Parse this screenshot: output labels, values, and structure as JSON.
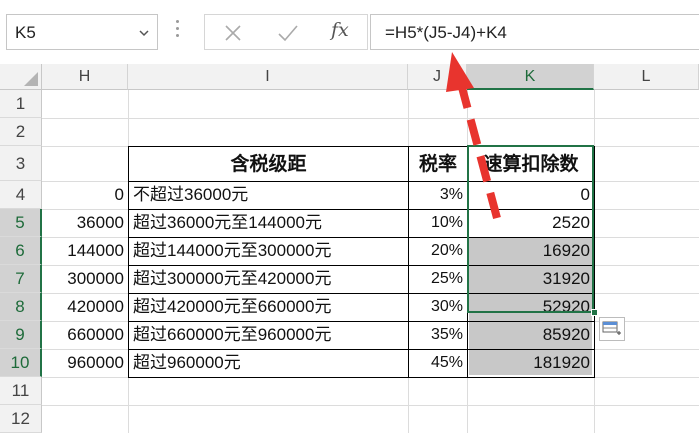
{
  "formula_bar": {
    "name_box": "K5",
    "fx_label": "fx",
    "formula": "=H5*(J5-J4)+K4"
  },
  "columns": [
    "H",
    "I",
    "J",
    "K",
    "L"
  ],
  "rows": [
    "1",
    "2",
    "3",
    "4",
    "5",
    "6",
    "7",
    "8",
    "9",
    "10",
    "11",
    "12"
  ],
  "table": {
    "header": {
      "range": "含税级距",
      "rate": "税率",
      "deduction": "速算扣除数"
    },
    "data": [
      {
        "h": "0",
        "range": "不超过36000元",
        "rate": "3%",
        "deduction": "0"
      },
      {
        "h": "36000",
        "range": "超过36000元至144000元",
        "rate": "10%",
        "deduction": "2520"
      },
      {
        "h": "144000",
        "range": "超过144000元至300000元",
        "rate": "20%",
        "deduction": "16920"
      },
      {
        "h": "300000",
        "range": "超过300000元至420000元",
        "rate": "25%",
        "deduction": "31920"
      },
      {
        "h": "420000",
        "range": "超过420000元至660000元",
        "rate": "30%",
        "deduction": "52920"
      },
      {
        "h": "660000",
        "range": "超过660000元至960000元",
        "rate": "35%",
        "deduction": "85920"
      },
      {
        "h": "960000",
        "range": "超过960000元",
        "rate": "45%",
        "deduction": "181920"
      }
    ]
  },
  "colors": {
    "accent": "#217346",
    "annotation_arrow": "#e8342e",
    "selection_fill": "#c8c8c8"
  }
}
